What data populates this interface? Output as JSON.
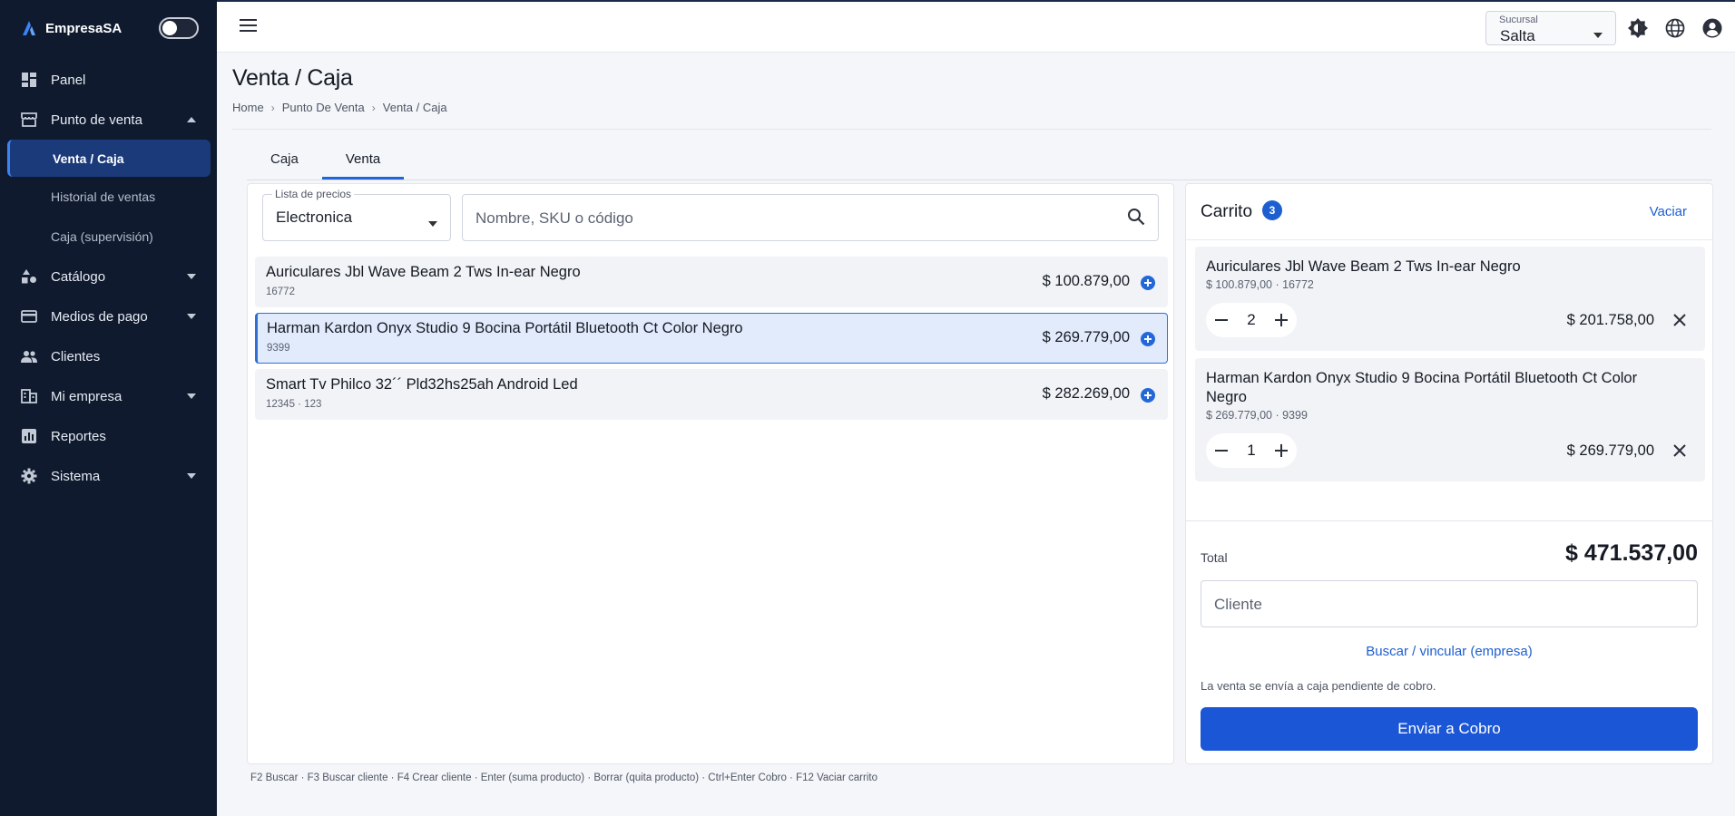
{
  "app": {
    "brand": "EmpresaSA"
  },
  "sidebar": {
    "items": [
      {
        "label": "Panel",
        "icon": "dashboard-icon"
      },
      {
        "label": "Punto de venta",
        "icon": "store-icon",
        "expanded": true,
        "children": [
          {
            "label": "Venta / Caja",
            "active": true
          },
          {
            "label": "Historial de ventas"
          },
          {
            "label": "Caja (supervisión)"
          }
        ]
      },
      {
        "label": "Catálogo",
        "icon": "catalog-icon"
      },
      {
        "label": "Medios de pago",
        "icon": "credit-card-icon"
      },
      {
        "label": "Clientes",
        "icon": "people-icon"
      },
      {
        "label": "Mi empresa",
        "icon": "business-icon"
      },
      {
        "label": "Reportes",
        "icon": "chart-icon"
      },
      {
        "label": "Sistema",
        "icon": "gear-icon"
      }
    ]
  },
  "topbar": {
    "branch": {
      "label": "Sucursal",
      "value": "Salta"
    }
  },
  "page": {
    "title": "Venta / Caja",
    "breadcrumb": [
      "Home",
      "Punto De Venta",
      "Venta / Caja"
    ]
  },
  "tabs": [
    {
      "label": "Caja",
      "active": false
    },
    {
      "label": "Venta",
      "active": true
    }
  ],
  "sale": {
    "price_list": {
      "label": "Lista de precios",
      "value": "Electronica"
    },
    "search": {
      "placeholder": "Nombre, SKU o código",
      "value": ""
    },
    "products": [
      {
        "name": "Auriculares Jbl Wave Beam 2 Tws In-ear Negro",
        "meta": "16772",
        "price": "$ 100.879,00",
        "selected": false
      },
      {
        "name": "Harman Kardon Onyx Studio 9 Bocina Portátil Bluetooth Ct Color Negro",
        "meta": "9399",
        "price": "$ 269.779,00",
        "selected": true
      },
      {
        "name": "Smart Tv Philco 32´´ Pld32hs25ah Android Led",
        "meta": "12345 · 123",
        "price": "$ 282.269,00",
        "selected": false
      }
    ],
    "shortcuts": "F2 Buscar · F3 Buscar cliente · F4 Crear cliente · Enter (suma producto) · Borrar (quita producto) · Ctrl+Enter Cobro · F12 Vaciar carrito"
  },
  "cart": {
    "title": "Carrito",
    "count": "3",
    "clear_label": "Vaciar",
    "items": [
      {
        "name": "Auriculares Jbl Wave Beam 2 Tws In-ear Negro",
        "meta": "$ 100.879,00 · 16772",
        "qty": "2",
        "total": "$ 201.758,00"
      },
      {
        "name": "Harman Kardon Onyx Studio 9 Bocina Portátil Bluetooth Ct Color Negro",
        "meta": "$ 269.779,00 · 9399",
        "qty": "1",
        "total": "$ 269.779,00"
      }
    ],
    "total_label": "Total",
    "total_value": "$ 471.537,00",
    "client": {
      "placeholder": "Cliente",
      "value": ""
    },
    "link_label": "Buscar / vincular (empresa)",
    "note": "La venta se envía a caja pendiente de cobro.",
    "submit_label": "Enviar a Cobro"
  },
  "colors": {
    "sidebar_bg": "#0f1a2e",
    "accent": "#1a56d6",
    "active_item_bg": "#1a3a7a"
  }
}
